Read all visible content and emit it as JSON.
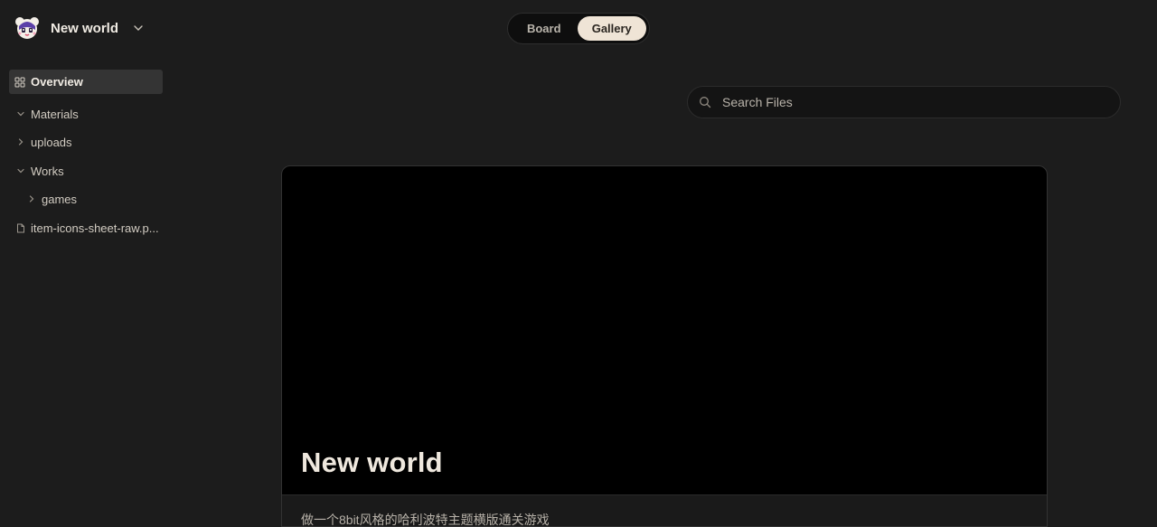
{
  "header": {
    "workspace_title": "New world"
  },
  "view_toggle": {
    "board_label": "Board",
    "gallery_label": "Gallery",
    "active": "Gallery"
  },
  "sidebar": {
    "overview_label": "Overview",
    "tree": [
      {
        "label": "Materials",
        "icon": "chevron-down-icon"
      },
      {
        "label": "uploads",
        "icon": "chevron-right-icon"
      },
      {
        "label": "Works",
        "icon": "chevron-down-icon"
      },
      {
        "label": "games",
        "icon": "chevron-right-icon"
      },
      {
        "label": "item-icons-sheet-raw.p...",
        "icon": "file-icon"
      }
    ]
  },
  "search": {
    "placeholder": "Search Files"
  },
  "card": {
    "title": "New world",
    "description": "做一个8bit风格的哈利波特主题横版通关游戏"
  },
  "colors": {
    "background": "#1c1c1c",
    "active_toggle": "#efe4d6",
    "sidebar_active": "#343434"
  }
}
